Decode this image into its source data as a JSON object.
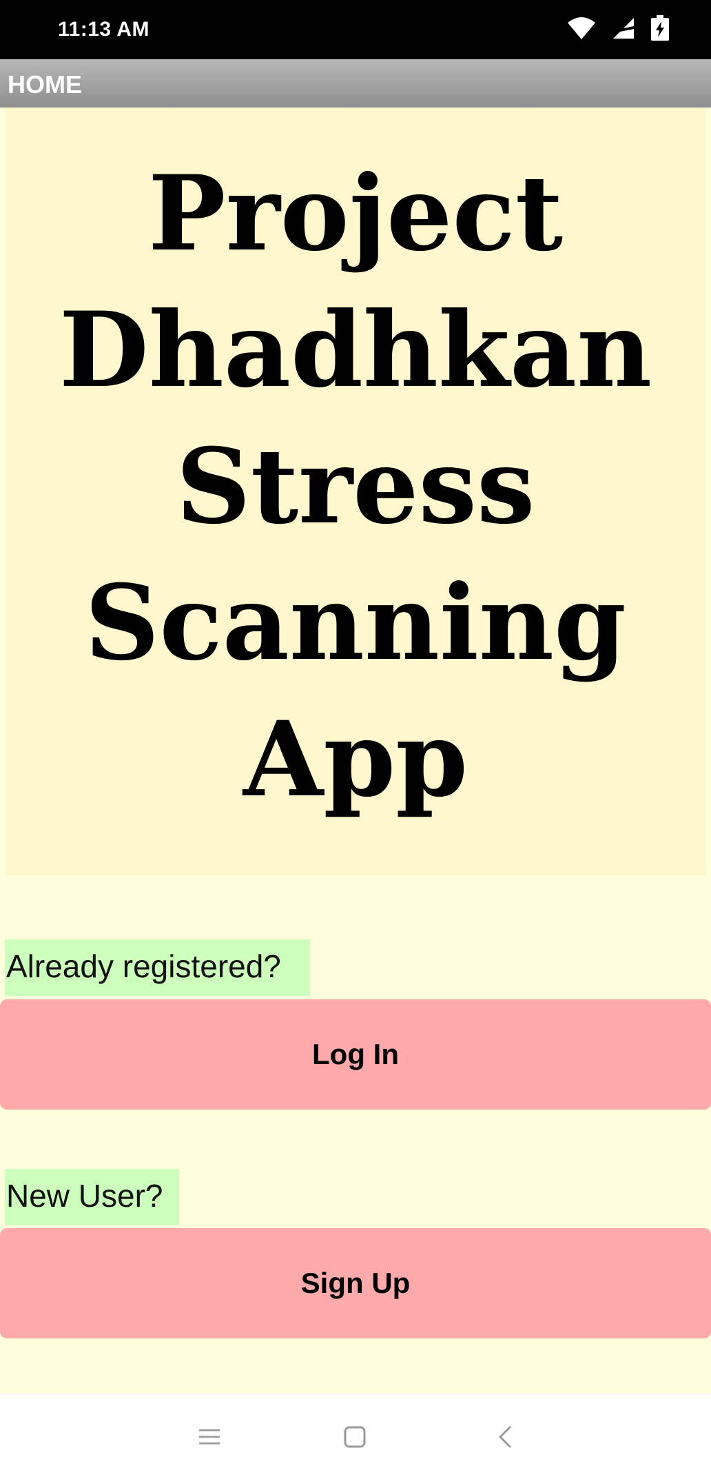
{
  "status_bar": {
    "time": "11:13 AM",
    "icons": [
      "wifi-icon",
      "cell-signal-icon",
      "battery-charging-icon"
    ]
  },
  "app_bar": {
    "title": "HOME"
  },
  "hero": {
    "title": "Project Dhadhkan Stress Scanning App"
  },
  "login_section": {
    "label": "Already registered?",
    "button_label": "Log In"
  },
  "signup_section": {
    "label": "New User?",
    "button_label": "Sign Up"
  },
  "nav_bar": {
    "icons": [
      "menu-icon",
      "home-square-icon",
      "back-icon"
    ]
  },
  "colors": {
    "page_background": "#ffffdd",
    "hero_background": "#fff8cf",
    "label_background": "#ccffbb",
    "button_background": "#ffaaaa",
    "app_bar_gradient_top": "#b8b8b8",
    "app_bar_gradient_bottom": "#8e8e8e"
  }
}
